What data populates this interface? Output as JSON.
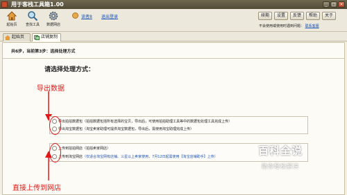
{
  "window": {
    "title": "用于客栈工具箱1.00",
    "minimize": "_",
    "maximize": "□",
    "close": "×"
  },
  "toolbar": {
    "tools": [
      {
        "label": "起始页",
        "icon": "home-icon"
      },
      {
        "label": "查找工具",
        "icon": "search-icon"
      },
      {
        "label": "数据网店",
        "icon": "gear-icon"
      }
    ],
    "user_name": "读者8",
    "logout_link": "退出登录",
    "buttons": [
      "续期",
      "设置",
      "反馈",
      "帮助",
      "关于"
    ],
    "notice_text": "不会使用或使用时遇到问题：",
    "notice_link": "联系客服"
  },
  "tabs": [
    {
      "label": "起始页",
      "icon": "home-icon",
      "active": false
    },
    {
      "label": "店铺复制",
      "icon": "copy-icon",
      "active": true
    }
  ],
  "panel": {
    "step_text": "共6步，当前第3步：选择处理方式",
    "choose_label": "请选择处理方式：",
    "options_group1": [
      {
        "text": "导出拍拍数据包（拍拍数据包括所有选择的宝贝，导出后，可使用拍拍助理工具等中的数据包处理工具完成上传）",
        "style": "normal"
      },
      {
        "text": "导出淘宝数据包（淘宝卖家助理可提供淘宝数据包，导出后，需使用淘宝助理完成上传）",
        "style": "normal"
      }
    ],
    "options_group2": [
      {
        "text": "上传到拍拍网店（拍拍卖家网店）",
        "style": "normal"
      },
      {
        "text": "上传到淘宝网店",
        "style": "normal",
        "warn": "（仅适合淘宝网有店铺、三星以上卖家使用，7月12日起需使用【淘宝店铺助手】上传）"
      }
    ]
  },
  "annotations": {
    "export_label": "导出数据",
    "upload_label": "直接上传到网店",
    "color": "#e01818"
  },
  "watermark": {
    "logo_text": "百科全说",
    "sub_text": "助你轻松解决"
  }
}
